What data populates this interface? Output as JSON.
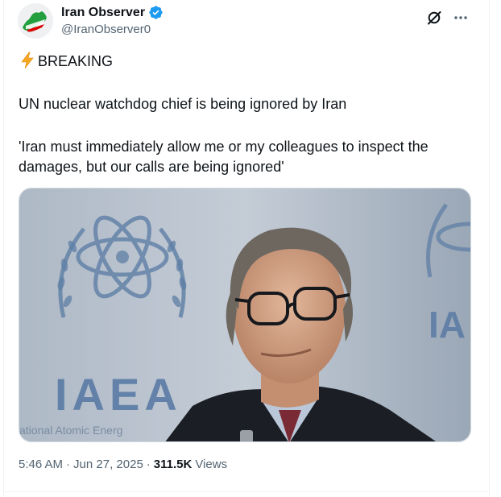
{
  "account": {
    "display_name": "Iran Observer",
    "handle": "@IranObserver0",
    "verified": true,
    "avatar_icon": "iran-flag-avatar"
  },
  "tweet": {
    "line1": "BREAKING",
    "line2": "UN nuclear watchdog chief is being ignored by Iran",
    "line3": "'Iran must immediately allow me or my colleagues to inspect the damages, but our calls are being ignored'"
  },
  "media": {
    "image_logo_text": "IAEA",
    "image_logo_text_partial": "IA",
    "image_subtext": "ational Atomic Energ",
    "image_icon": "photo-iaea-press-conference"
  },
  "meta": {
    "time": "5:46 AM",
    "date": "Jun 27, 2025",
    "views_count": "311.5K",
    "views_label": "Views"
  },
  "icons": {
    "grok": "grok-icon",
    "more": "more-icon",
    "verified": "verified-badge-icon",
    "bolt": "lightning-bolt-icon"
  },
  "colors": {
    "verified_blue": "#1d9bf0",
    "text": "#0f1419",
    "muted": "#536471",
    "flag_green": "#239f40",
    "flag_red": "#da0000"
  }
}
